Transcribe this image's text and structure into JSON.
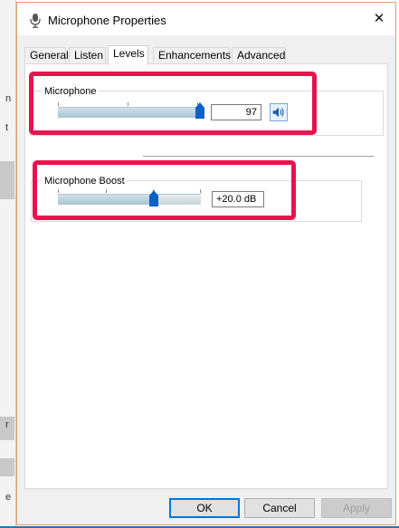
{
  "window": {
    "title": "Microphone Properties",
    "close_glyph": "✕"
  },
  "background_fragments": [
    "n",
    "t",
    "r",
    "e",
    "e"
  ],
  "tabs": [
    {
      "label": "General",
      "active": false
    },
    {
      "label": "Listen",
      "active": false
    },
    {
      "label": "Levels",
      "active": true
    },
    {
      "label": "Enhancements",
      "active": false
    },
    {
      "label": "Advanced",
      "active": false
    }
  ],
  "levels": {
    "microphone": {
      "label": "Microphone",
      "value": "97",
      "level_percent": 97,
      "speaker_icon": "speaker-icon"
    },
    "boost": {
      "label": "Microphone Boost",
      "value": "+20.0 dB",
      "level_percent": 67
    }
  },
  "buttons": {
    "ok": "OK",
    "cancel": "Cancel",
    "apply": "Apply"
  },
  "colors": {
    "highlight": "#e8134d",
    "thumb": "#0a62c4",
    "accent": "#0078d7"
  }
}
